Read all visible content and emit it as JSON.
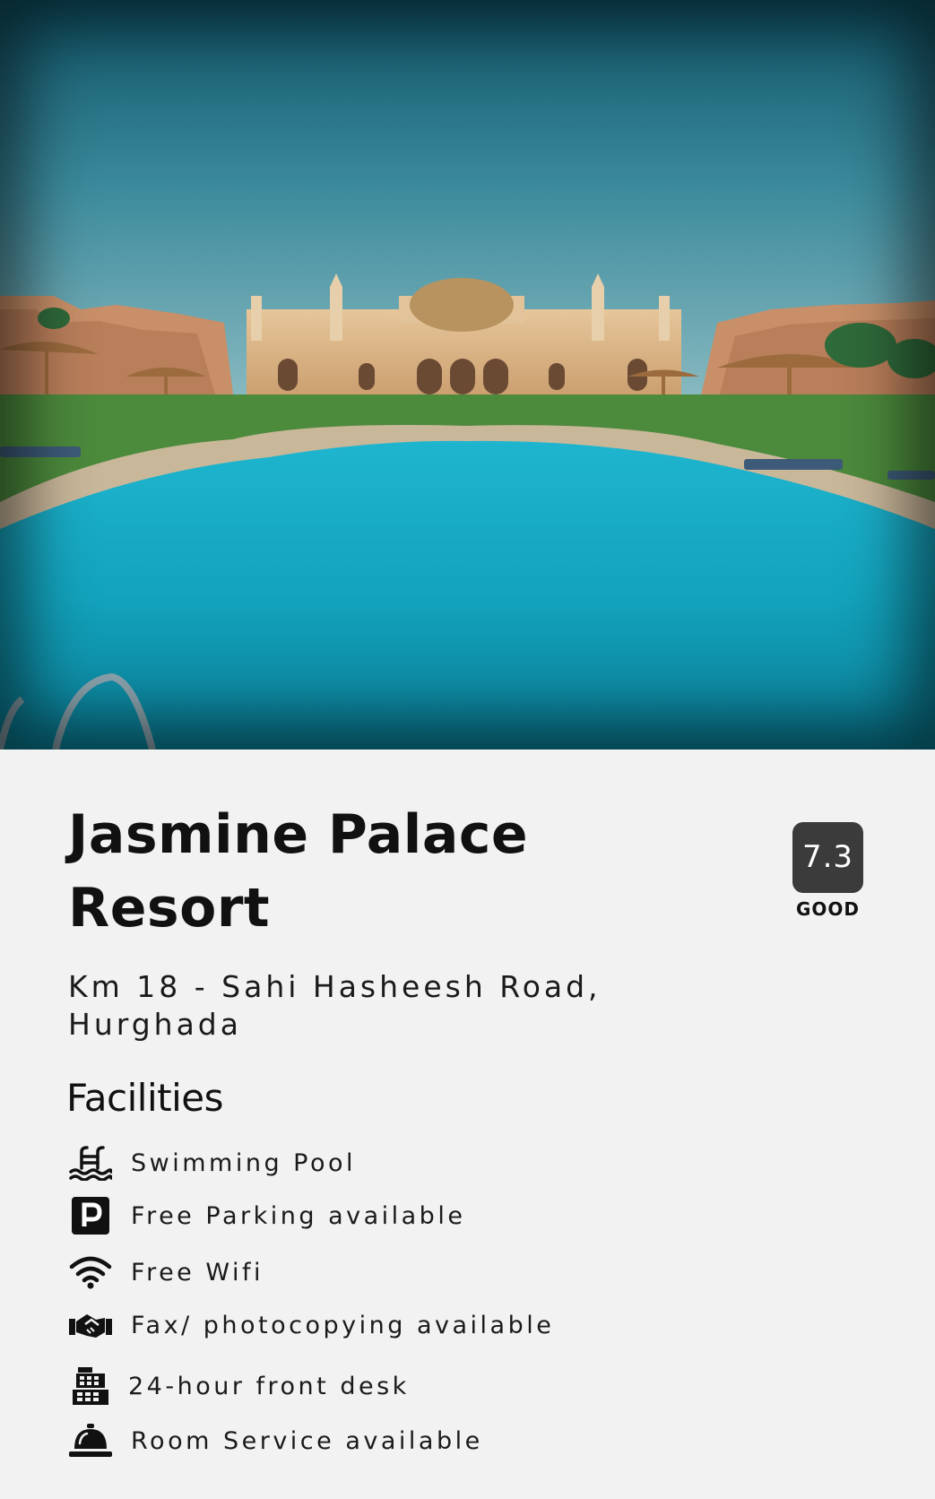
{
  "hotel": {
    "name": "Jasmine Palace Resort",
    "address": "Km 18 - Sahi  Hasheesh Road, Hurghada",
    "rating": {
      "score": "7.3",
      "label": "GOOD"
    }
  },
  "facilities": {
    "heading": "Facilities",
    "items": [
      {
        "icon": "swimming-pool-icon",
        "label": "Swimming Pool"
      },
      {
        "icon": "parking-icon",
        "label": "Free Parking available"
      },
      {
        "icon": "wifi-icon",
        "label": "Free Wifi"
      },
      {
        "icon": "fax-icon",
        "label": "Fax/ photocopying available"
      },
      {
        "icon": "front-desk-icon",
        "label": "24-hour front desk"
      },
      {
        "icon": "room-service-bell-icon",
        "label": "Room Service available"
      }
    ]
  },
  "colors": {
    "background": "#f2f2f2",
    "badge": "#3b3b3b",
    "text": "#111111",
    "pool": "#16a9c4",
    "sky": "#1d6f85"
  }
}
